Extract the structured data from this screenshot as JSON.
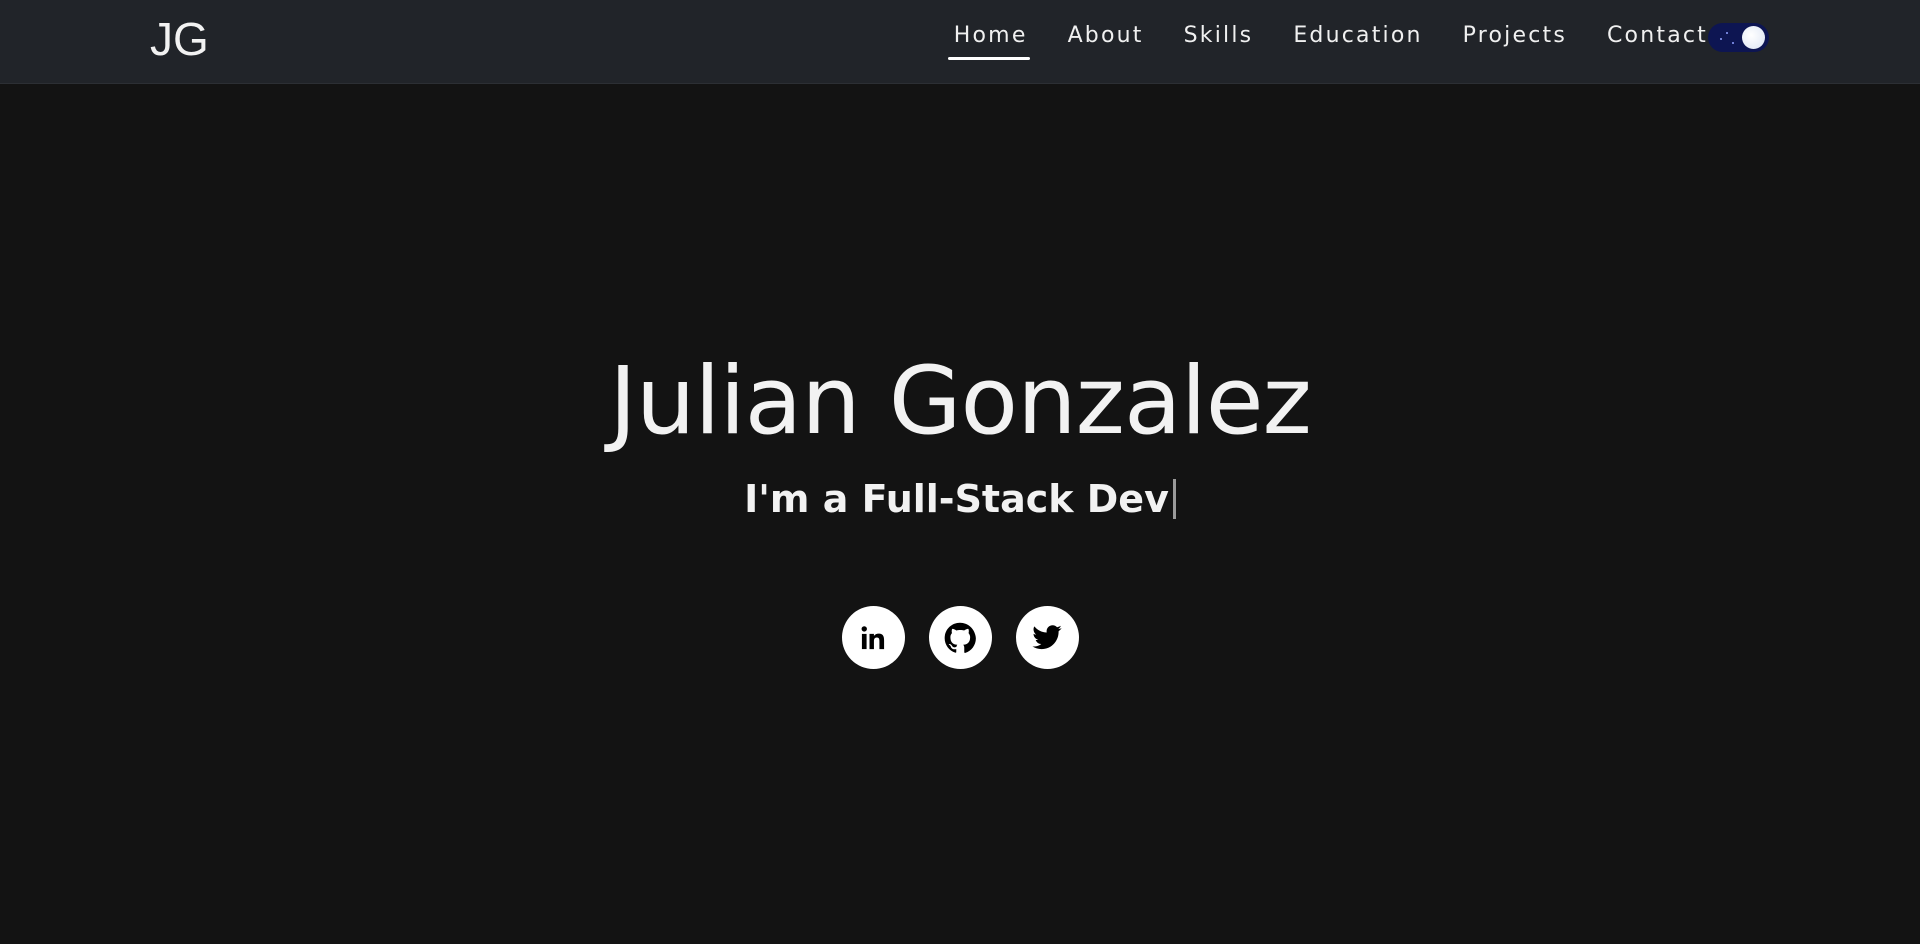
{
  "navbar": {
    "logo": "JG",
    "links": [
      {
        "label": "Home",
        "active": true
      },
      {
        "label": "About",
        "active": false
      },
      {
        "label": "Skills",
        "active": false
      },
      {
        "label": "Education",
        "active": false
      },
      {
        "label": "Projects",
        "active": false
      },
      {
        "label": "Contact",
        "active": false
      }
    ],
    "theme_toggle": {
      "state": "dark",
      "track_color": "#0d1552"
    }
  },
  "hero": {
    "name": "Julian Gonzalez",
    "subtitle_prefix": "I'm a ",
    "subtitle_role": "Full-Stack Dev"
  },
  "socials": [
    {
      "icon": "linkedin-icon"
    },
    {
      "icon": "github-icon"
    },
    {
      "icon": "twitter-icon"
    }
  ],
  "colors": {
    "background": "#131313",
    "navbar": "#212429",
    "text": "#f2f2f2"
  }
}
